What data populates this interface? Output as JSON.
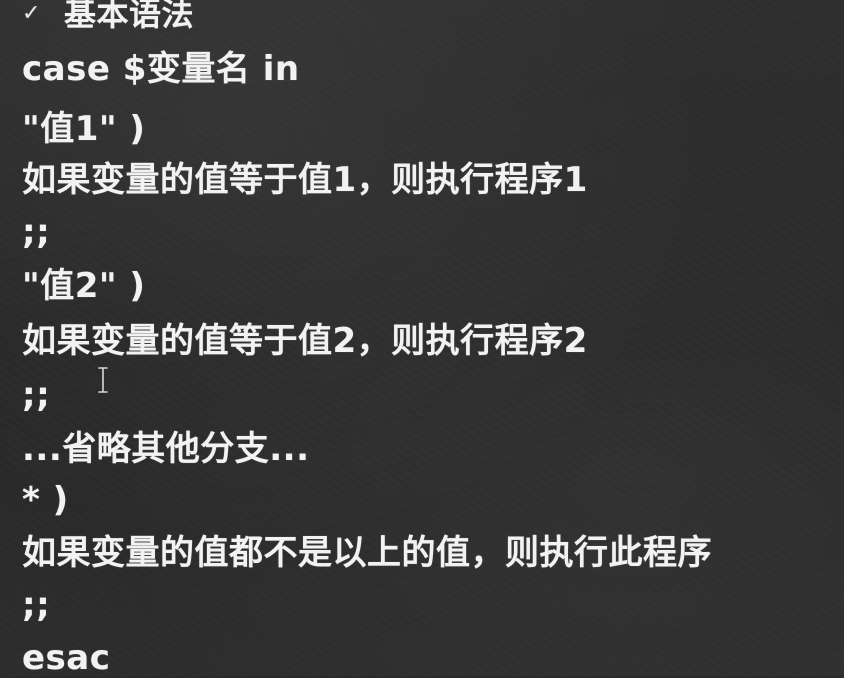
{
  "heading": {
    "check_glyph": "✓",
    "title": "基本语法"
  },
  "code_lines": [
    "case $变量名 in",
    "\"值1\" )",
    "如果变量的值等于值1，则执行程序1",
    ";;",
    "\"值2\" )",
    "如果变量的值等于值2，则执行程序2",
    ";;",
    "...省略其他分支...",
    "* )",
    "如果变量的值都不是以上的值，则执行此程序",
    ";;",
    "esac"
  ],
  "icons": {
    "check": "check-icon",
    "cursor": "text-cursor-icon"
  },
  "colors": {
    "background": "#2b2b2b",
    "text": "#f2f2f2"
  }
}
